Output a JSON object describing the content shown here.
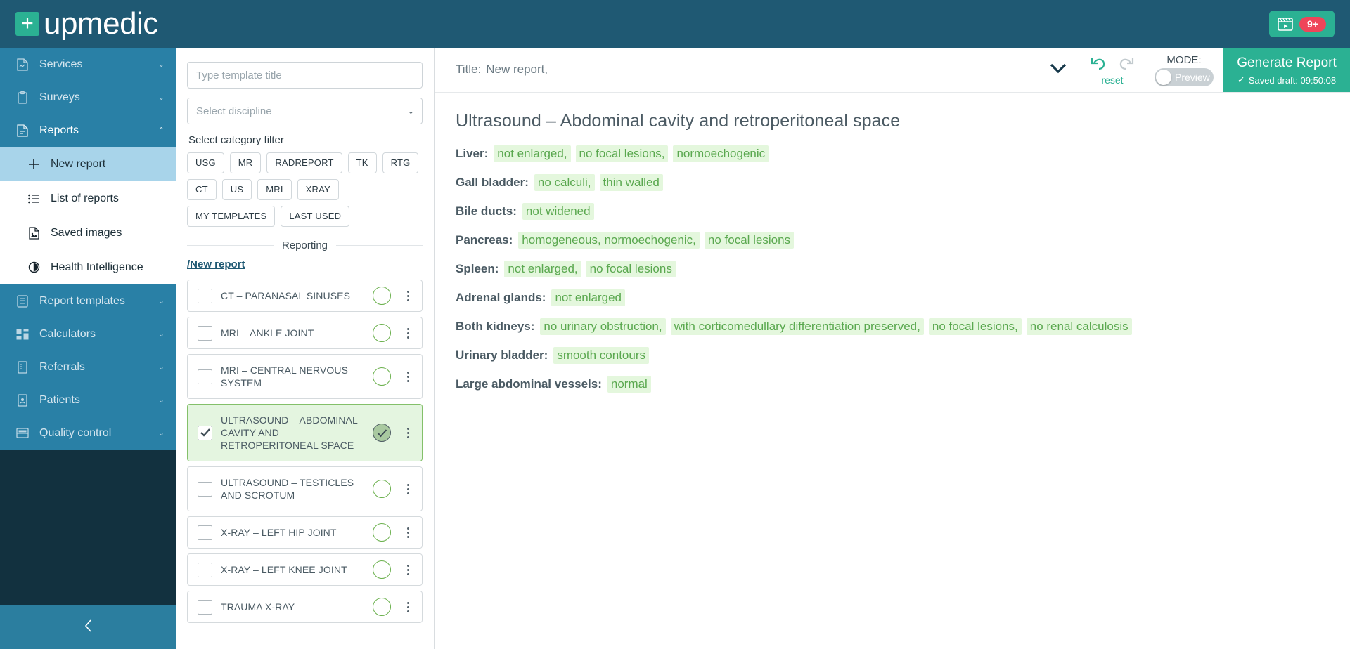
{
  "topbar": {
    "logo_text": "upmedic",
    "logo_mark": "plus-icon",
    "video_icon": "clapperboard-play-icon",
    "notification_badge": "9+"
  },
  "sidebar": {
    "items_top": [
      {
        "label": "Services",
        "icon": "services-document-icon",
        "chevron": "⌄"
      },
      {
        "label": "Surveys",
        "icon": "clipboard-icon",
        "chevron": "⌄"
      },
      {
        "label": "Reports",
        "icon": "report-document-icon",
        "chevron": "⌃"
      }
    ],
    "submenu": [
      {
        "label": "New report",
        "icon": "plus-icon",
        "active": true
      },
      {
        "label": "List of reports",
        "icon": "list-icon",
        "active": false
      },
      {
        "label": "Saved images",
        "icon": "image-document-icon",
        "active": false
      },
      {
        "label": "Health Intelligence",
        "icon": "health-intelligence-icon",
        "active": false
      }
    ],
    "items_bottom": [
      {
        "label": "Report templates",
        "icon": "templates-icon",
        "chevron": "⌄"
      },
      {
        "label": "Calculators",
        "icon": "calculator-icon",
        "chevron": "⌄"
      },
      {
        "label": "Referrals",
        "icon": "referral-icon",
        "chevron": "⌄"
      },
      {
        "label": "Patients",
        "icon": "patient-card-icon",
        "chevron": "⌄"
      },
      {
        "label": "Quality control",
        "icon": "quality-control-icon",
        "chevron": "⌄"
      }
    ],
    "collapse_icon": "chevron-left-icon"
  },
  "template_panel": {
    "title_placeholder": "Type template title",
    "title_value": "",
    "discipline_placeholder": "Select discipline",
    "discipline_caret": "⌄",
    "filter_label": "Select category filter",
    "chips": [
      "USG",
      "MR",
      "RADREPORT",
      "TK",
      "RTG",
      "CT",
      "US",
      "MRI",
      "XRAY",
      "MY TEMPLATES",
      "LAST USED"
    ],
    "section_divider": "Reporting",
    "breadcrumb": "/New report",
    "templates": [
      {
        "name": "CT – PARANASAL SINUSES",
        "checked": false
      },
      {
        "name": "MRI – ANKLE JOINT",
        "checked": false
      },
      {
        "name": "MRI – CENTRAL NERVOUS SYSTEM",
        "checked": false
      },
      {
        "name": "ULTRASOUND – ABDOMINAL CAVITY AND RETROPERITONEAL SPACE",
        "checked": true
      },
      {
        "name": "ULTRASOUND – TESTICLES AND SCROTUM",
        "checked": false
      },
      {
        "name": "X-RAY – LEFT HIP JOINT",
        "checked": false
      },
      {
        "name": "X-RAY – LEFT KNEE JOINT",
        "checked": false
      },
      {
        "name": "TRAUMA X-RAY",
        "checked": false
      }
    ]
  },
  "report_header": {
    "title_label": "Title:",
    "title_value": "New report,",
    "expand_icon": "chevron-down-icon",
    "undo_icon": "undo-icon",
    "redo_icon": "redo-icon",
    "reset_label": "reset",
    "mode_label": "MODE:",
    "toggle_label": "Preview",
    "generate_label": "Generate Report",
    "saved_draft": "Saved draft: 09:50:08",
    "saved_check": "✓"
  },
  "report": {
    "heading": "Ultrasound – Abdominal cavity and retroperitoneal space",
    "findings": [
      {
        "label": "Liver:",
        "values": [
          "not enlarged,",
          "no focal lesions,",
          "normoechogenic"
        ]
      },
      {
        "label": "Gall bladder:",
        "values": [
          "no calculi,",
          "thin walled"
        ]
      },
      {
        "label": "Bile ducts:",
        "values": [
          "not widened"
        ]
      },
      {
        "label": "Pancreas:",
        "values": [
          "homogeneous, normoechogenic,",
          "no focal lesions"
        ]
      },
      {
        "label": "Spleen:",
        "values": [
          "not enlarged,",
          "no focal lesions"
        ]
      },
      {
        "label": "Adrenal glands:",
        "values": [
          "not enlarged"
        ]
      },
      {
        "label": "Both kidneys:",
        "values": [
          "no urinary obstruction,",
          "with corticomedullary differentiation preserved,",
          "no focal lesions,",
          "no renal calculosis"
        ]
      },
      {
        "label": "Urinary bladder:",
        "values": [
          "smooth contours"
        ]
      },
      {
        "label": "Large abdominal vessels:",
        "values": [
          "normal"
        ]
      }
    ]
  },
  "colors": {
    "brand_teal": "#2bb193",
    "sidebar_blue": "#2980a6",
    "topbar_blue": "#1f5973",
    "highlight_green": "#e4f7dd",
    "text_green": "#5aa84f",
    "badge_red": "#ef4559"
  }
}
